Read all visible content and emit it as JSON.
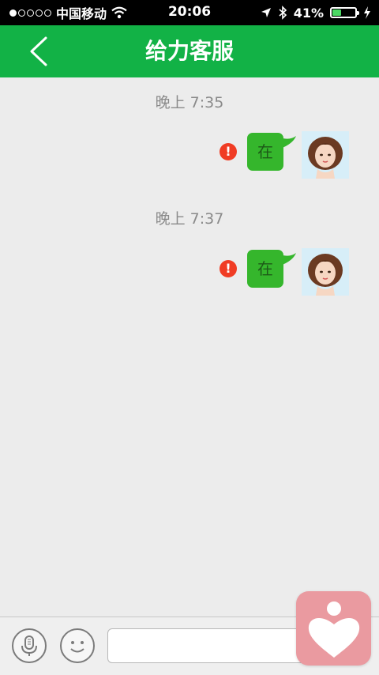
{
  "status_bar": {
    "carrier": "中国移动",
    "time": "20:06",
    "battery_text": "41%",
    "battery_level": 0.41,
    "icons": [
      "wifi-icon",
      "location-arrow-icon",
      "bluetooth-icon",
      "charging-bolt-icon"
    ]
  },
  "nav": {
    "title": "给力客服",
    "back_icon": "chevron-left-icon"
  },
  "chat": {
    "groups": [
      {
        "timestamp": "晚上 7:35",
        "message": "在",
        "status": "failed"
      },
      {
        "timestamp": "晚上 7:37",
        "message": "在",
        "status": "failed"
      }
    ]
  },
  "input_bar": {
    "voice_icon": "microphone-icon",
    "emoji_icon": "smiley-icon",
    "text_value": "",
    "placeholder": ""
  },
  "floating_button": {
    "icon": "heart-icon"
  },
  "colors": {
    "nav_green": "#12b246",
    "bubble_green": "#35b62c",
    "error_red": "#f03c24",
    "background": "#ececec",
    "float_pink": "#ea9aa0"
  }
}
